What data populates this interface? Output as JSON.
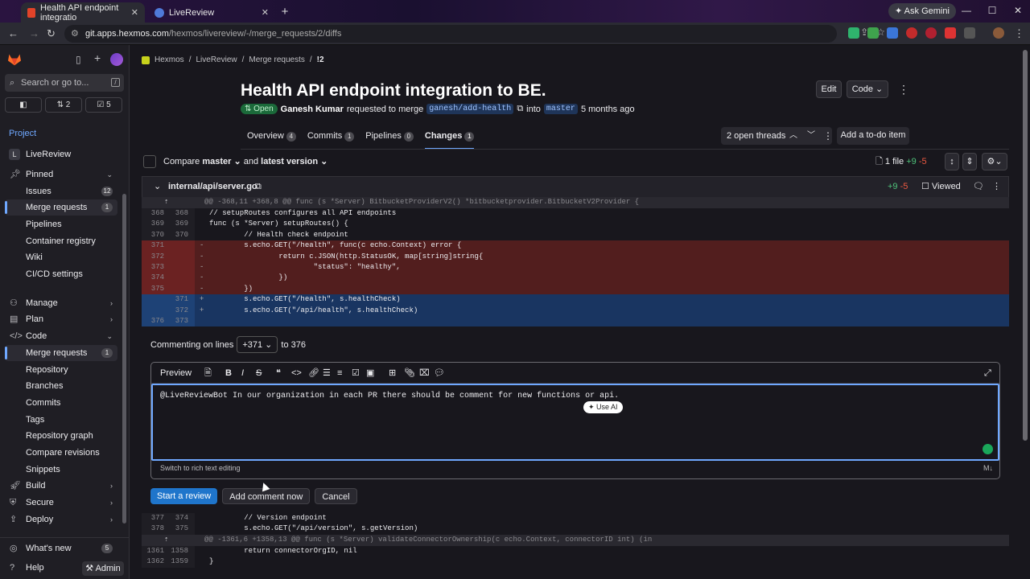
{
  "browser": {
    "tabs": [
      {
        "title": "Health API endpoint integratio",
        "active": true
      },
      {
        "title": "LiveReview",
        "active": false
      }
    ],
    "url_host": "git.apps.hexmos.com",
    "url_path": "/hexmos/livereview/-/merge_requests/2/diffs",
    "ask_gemini": "Ask Gemini"
  },
  "sidebar": {
    "search_placeholder": "Search or go to...",
    "counts": {
      "issues_icon": "",
      "mrs": "2",
      "todos": "5"
    },
    "project_label": "Project",
    "project_name": "LiveReview",
    "project_initial": "L",
    "pinned": "Pinned",
    "pinned_items": [
      {
        "label": "Issues",
        "badge": "12"
      },
      {
        "label": "Merge requests",
        "badge": "1"
      },
      {
        "label": "Pipelines"
      },
      {
        "label": "Container registry"
      },
      {
        "label": "Wiki"
      },
      {
        "label": "CI/CD settings"
      }
    ],
    "groups": [
      {
        "label": "Manage"
      },
      {
        "label": "Plan"
      },
      {
        "label": "Code"
      }
    ],
    "code_items": [
      {
        "label": "Merge requests",
        "badge": "1"
      },
      {
        "label": "Repository"
      },
      {
        "label": "Branches"
      },
      {
        "label": "Commits"
      },
      {
        "label": "Tags"
      },
      {
        "label": "Repository graph"
      },
      {
        "label": "Compare revisions"
      },
      {
        "label": "Snippets"
      }
    ],
    "lower_groups": [
      {
        "label": "Build"
      },
      {
        "label": "Secure"
      },
      {
        "label": "Deploy"
      }
    ],
    "whats_new": "What's new",
    "whats_new_badge": "5",
    "help": "Help",
    "admin": "Admin"
  },
  "breadcrumb": [
    "Hexmos",
    "LiveReview",
    "Merge requests",
    "!2"
  ],
  "mr": {
    "title": "Health API endpoint integration to BE.",
    "status": "Open",
    "author": "Ganesh Kumar",
    "requested_text": "requested to merge",
    "source_branch": "ganesh/add-health",
    "into_text": "into",
    "target_branch": "master",
    "time": "5 months ago",
    "edit": "Edit",
    "code": "Code"
  },
  "tabs": [
    {
      "label": "Overview",
      "count": "4"
    },
    {
      "label": "Commits",
      "count": "1"
    },
    {
      "label": "Pipelines",
      "count": "0"
    },
    {
      "label": "Changes",
      "count": "1"
    }
  ],
  "threads": "2 open threads",
  "todo": "Add a to-do item",
  "compare": {
    "label": "Compare",
    "base": "master",
    "and": "and",
    "head": "latest version",
    "files": "1 file",
    "add": "+9",
    "del": "-5"
  },
  "file": {
    "path": "internal/api/server.go",
    "add": "+9",
    "del": "-5",
    "viewed": "Viewed"
  },
  "diff_lines": [
    {
      "type": "hunk",
      "code": "@@ -368,11 +368,8 @@ func (s *Server) BitbucketProviderV2() *bitbucketprovider.BitbucketV2Provider {"
    },
    {
      "type": "ctx",
      "old": "368",
      "new": "368",
      "code": "// setupRoutes configures all API endpoints"
    },
    {
      "type": "ctx",
      "old": "369",
      "new": "369",
      "code": "func (s *Server) setupRoutes() {"
    },
    {
      "type": "ctx",
      "old": "370",
      "new": "370",
      "code": "        // Health check endpoint"
    },
    {
      "type": "del",
      "old": "371",
      "new": "",
      "code": "        s.echo.GET(\"/health\", func(c echo.Context) error {"
    },
    {
      "type": "del",
      "old": "372",
      "new": "",
      "code": "                return c.JSON(http.StatusOK, map[string]string{"
    },
    {
      "type": "del",
      "old": "373",
      "new": "",
      "code": "                        \"status\": \"healthy\","
    },
    {
      "type": "del",
      "old": "374",
      "new": "",
      "code": "                })"
    },
    {
      "type": "del",
      "old": "375",
      "new": "",
      "code": "        })"
    },
    {
      "type": "add",
      "old": "",
      "new": "371",
      "code": "        s.echo.GET(\"/health\", s.healthCheck)"
    },
    {
      "type": "add",
      "old": "",
      "new": "372",
      "code": "        s.echo.GET(\"/api/health\", s.healthCheck)"
    },
    {
      "type": "add",
      "old": "376",
      "new": "373",
      "code": ""
    }
  ],
  "commenting": {
    "label": "Commenting on lines",
    "from": "+371",
    "to_text": "to 376"
  },
  "editor": {
    "preview": "Preview",
    "text": "@LiveReviewBot In our organization in each PR there should be comment for new functions or api.",
    "use_ai": "Use AI",
    "rich_switch": "Switch to rich text editing"
  },
  "actions": {
    "start_review": "Start a review",
    "add_now": "Add comment now",
    "cancel": "Cancel"
  },
  "diff_lines2": [
    {
      "type": "ctx",
      "old": "377",
      "new": "374",
      "code": "        // Version endpoint"
    },
    {
      "type": "ctx",
      "old": "378",
      "new": "375",
      "code": "        s.echo.GET(\"/api/version\", s.getVersion)"
    },
    {
      "type": "hunk",
      "code": "@@ -1361,6 +1358,13 @@ func (s *Server) validateConnectorOwnership(c echo.Context, connectorID int) (in"
    },
    {
      "type": "ctx",
      "old": "1361",
      "new": "1358",
      "code": "        return connectorOrgID, nil"
    },
    {
      "type": "ctx",
      "old": "1362",
      "new": "1359",
      "code": "}"
    }
  ]
}
